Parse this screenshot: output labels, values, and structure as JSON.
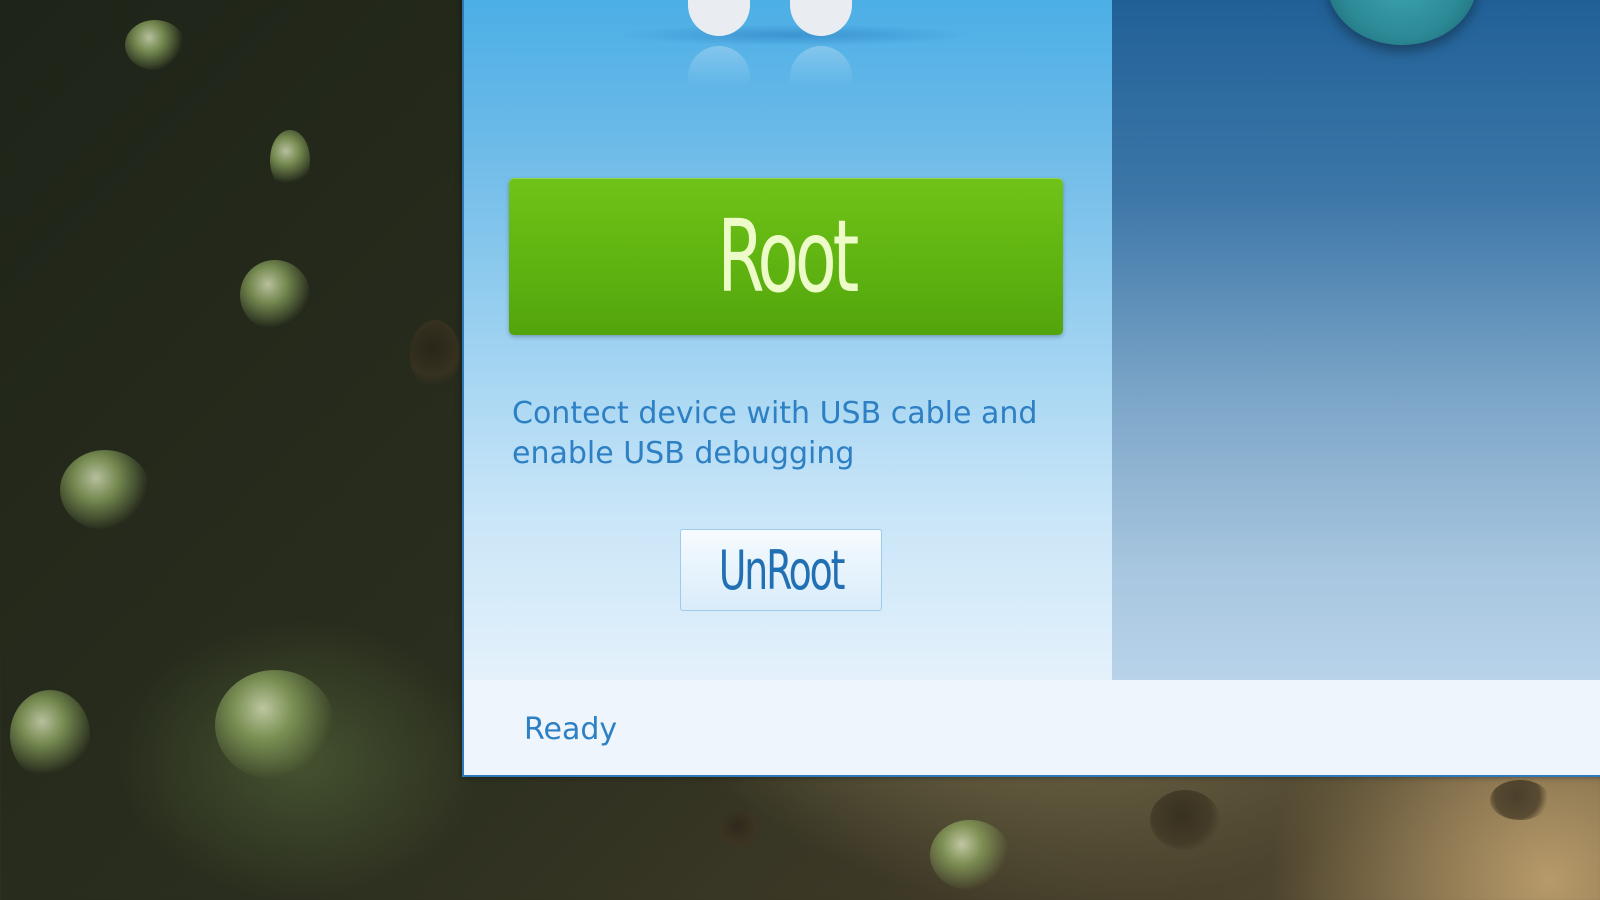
{
  "app": {
    "primary_action": {
      "label": "Root",
      "color": "#5eb210"
    },
    "instructions": "Contect device with USB cable and enable USB debugging",
    "secondary_action": {
      "label": "UnRoot"
    },
    "status": "Ready",
    "accent_color": "#2d80c4"
  }
}
